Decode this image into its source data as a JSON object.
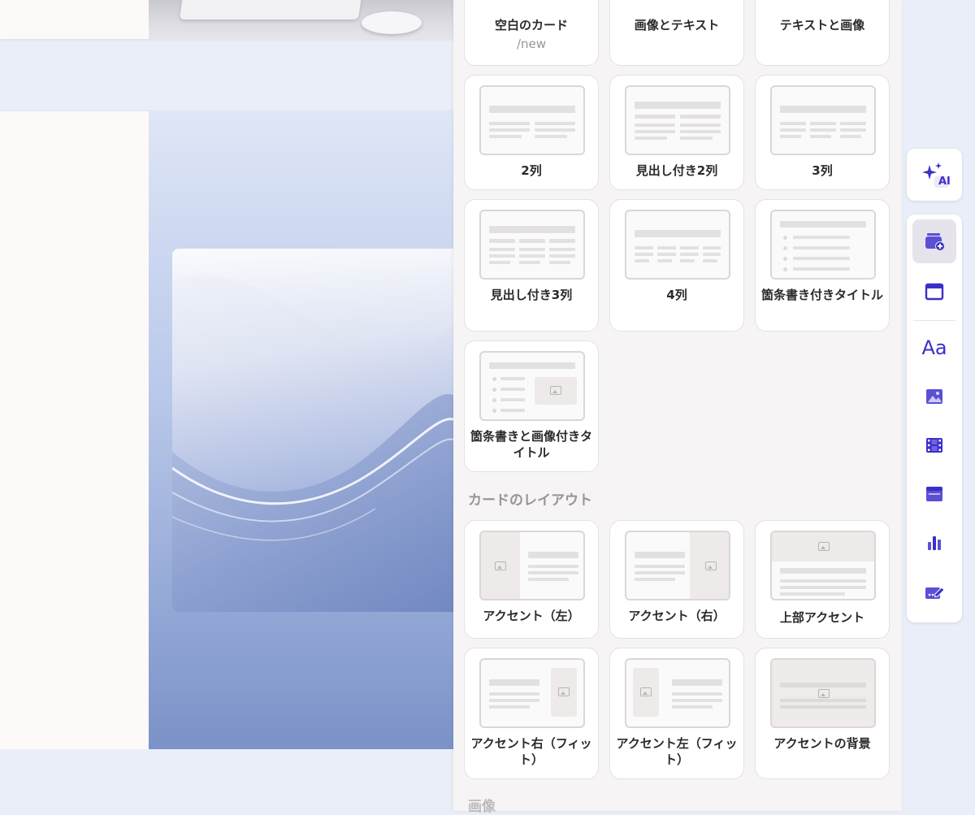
{
  "colors": {
    "accent": "#3b2fc9",
    "panel_bg": "#f6f4f4",
    "card_bg": "#ffffff",
    "label_text": "#2c2a2a",
    "muted_text": "#9a9595"
  },
  "panel": {
    "top_cards": [
      {
        "label": "空白のカード",
        "sub": "/new"
      },
      {
        "label": "画像とテキスト"
      },
      {
        "label": "テキストと画像"
      }
    ],
    "text_cards": [
      {
        "label": "2列"
      },
      {
        "label": "見出し付き2列"
      },
      {
        "label": "3列"
      },
      {
        "label": "見出し付き3列"
      },
      {
        "label": "4列"
      },
      {
        "label": "箇条書き付きタイトル"
      },
      {
        "label": "箇条書きと画像付きタイトル"
      }
    ],
    "layout_section": {
      "title": "カードのレイアウト",
      "cards": [
        {
          "label": "アクセント（左）"
        },
        {
          "label": "アクセント（右）"
        },
        {
          "label": "上部アクセント"
        },
        {
          "label": "アクセント右（フィット）"
        },
        {
          "label": "アクセント左（フィット）"
        },
        {
          "label": "アクセントの背景"
        }
      ]
    },
    "image_section": {
      "title": "画像"
    }
  },
  "toolbar": {
    "ai_badge": "AI",
    "tools": [
      {
        "icon": "add-card-icon",
        "active": true
      },
      {
        "icon": "layout-icon",
        "active": false
      },
      {
        "icon": "text-icon",
        "glyph": "Aa",
        "active": false
      },
      {
        "icon": "image-icon",
        "active": false
      },
      {
        "icon": "video-icon",
        "active": false
      },
      {
        "icon": "embed-icon",
        "active": false
      },
      {
        "icon": "chart-icon",
        "active": false
      },
      {
        "icon": "form-icon",
        "active": false
      }
    ]
  }
}
